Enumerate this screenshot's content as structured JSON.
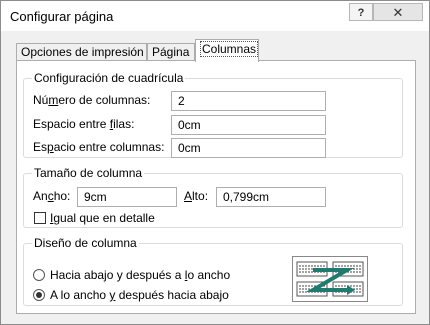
{
  "window": {
    "title": "Configurar página",
    "help_label": "?",
    "close_label": "✕"
  },
  "tabs": [
    {
      "label": "Opciones de impresión"
    },
    {
      "label": "Página"
    },
    {
      "label": "Columnas"
    }
  ],
  "grid_config": {
    "legend": "Configuración de cuadrícula",
    "columns": {
      "label_pre": "Nú",
      "label_u": "m",
      "label_post": "ero de columnas:",
      "value": "2"
    },
    "row_spacing": {
      "label_pre": "Espacio entre ",
      "label_u": "f",
      "label_post": "ilas:",
      "value": "0cm"
    },
    "col_spacing": {
      "label_pre": "Es",
      "label_u": "p",
      "label_post": "acio entre columnas:",
      "value": "0cm"
    }
  },
  "column_size": {
    "legend": "Tamaño de columna",
    "width": {
      "label_pre": "An",
      "label_u": "c",
      "label_post": "ho:",
      "value": "9cm"
    },
    "height": {
      "label_pre": "",
      "label_u": "A",
      "label_post": "lto:",
      "value": "0,799cm"
    },
    "same_as_detail": {
      "label_pre": "",
      "label_u": "I",
      "label_post": "gual que en detalle",
      "checked": false
    }
  },
  "column_layout": {
    "legend": "Diseño de columna",
    "options": [
      {
        "label_pre": "Hacia abajo y después a ",
        "label_u": "l",
        "label_post": "o ancho",
        "selected": false
      },
      {
        "label_pre": "A lo ancho ",
        "label_u": "y",
        "label_post": " después hacia abajo",
        "selected": true
      }
    ],
    "preview_icon": "across-then-down-layout-icon",
    "accent_color": "#1e7b6e"
  }
}
